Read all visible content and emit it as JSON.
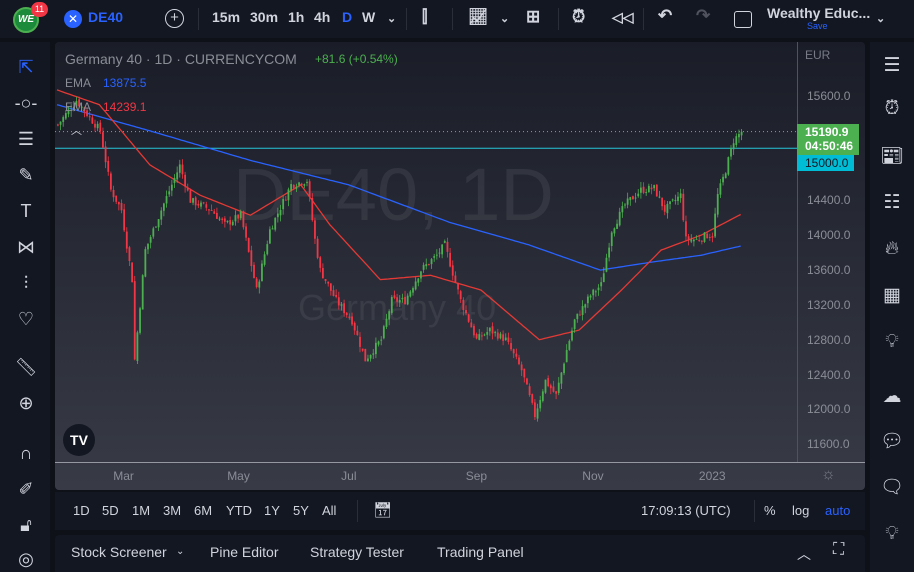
{
  "topbar": {
    "notif_count": "11",
    "symbol": "DE40",
    "intervals": [
      "15m",
      "30m",
      "1h",
      "4h",
      "D",
      "W"
    ],
    "active_interval": "D",
    "layout_name": "Wealthy Educ...",
    "save_label": "Save"
  },
  "legend": {
    "title": "Germany 40 · 1D · CURRENCYCOM",
    "change": "+81.6 (+0.54%)",
    "ema1_label": "EMA",
    "ema1_value": "13875.5",
    "ema2_label": "EMA",
    "ema2_value": "14239.1"
  },
  "watermark": {
    "main": "DE40, 1D",
    "sub": "Germany 40"
  },
  "price_axis": {
    "currency": "EUR",
    "last_price": "15190.9",
    "countdown": "04:50:46",
    "line_price": "15000.0"
  },
  "bottom": {
    "ranges": [
      "1D",
      "5D",
      "1M",
      "3M",
      "6M",
      "YTD",
      "1Y",
      "5Y",
      "All"
    ],
    "time": "17:09:13 (UTC)",
    "pct": "%",
    "log": "log",
    "auto": "auto"
  },
  "panel": {
    "tabs": [
      "Stock Screener",
      "Pine Editor",
      "Strategy Tester",
      "Trading Panel"
    ]
  },
  "colors": {
    "up": "#4caf50",
    "down": "#f23645",
    "ema_blue": "#2962ff",
    "ema_red": "#e53935",
    "hline": "#26c6da",
    "accent": "#2962ff"
  },
  "chart_data": {
    "type": "candlestick",
    "title": "Germany 40 · 1D · CURRENCYCOM",
    "ylim": [
      11400,
      15900
    ],
    "yticks": [
      15600,
      15200,
      14800,
      14400,
      14000,
      13600,
      13200,
      12800,
      12400,
      12000,
      11600
    ],
    "ytick_labels": [
      "15600.0",
      "14400.0",
      "14000.0",
      "13600.0",
      "13200.0",
      "12800.0",
      "12400.0",
      "12000.0",
      "11600.0"
    ],
    "xticks": [
      {
        "bar": 25,
        "label": "Mar"
      },
      {
        "bar": 68,
        "label": "May"
      },
      {
        "bar": 111,
        "label": "Jul"
      },
      {
        "bar": 158,
        "label": "Sep"
      },
      {
        "bar": 202,
        "label": "Nov"
      },
      {
        "bar": 246,
        "label": "2023"
      }
    ],
    "bars": 258,
    "close_path": [
      [
        0,
        15270
      ],
      [
        7,
        15550
      ],
      [
        16,
        15200
      ],
      [
        20,
        14520
      ],
      [
        24,
        14290
      ],
      [
        28,
        13490
      ],
      [
        29,
        12570
      ],
      [
        33,
        13830
      ],
      [
        39,
        14290
      ],
      [
        46,
        14800
      ],
      [
        50,
        14400
      ],
      [
        58,
        14290
      ],
      [
        63,
        14120
      ],
      [
        69,
        14230
      ],
      [
        75,
        13370
      ],
      [
        80,
        14060
      ],
      [
        88,
        14580
      ],
      [
        94,
        14630
      ],
      [
        97,
        13950
      ],
      [
        99,
        13600
      ],
      [
        105,
        13250
      ],
      [
        111,
        13020
      ],
      [
        116,
        12570
      ],
      [
        122,
        12800
      ],
      [
        126,
        13250
      ],
      [
        131,
        13250
      ],
      [
        137,
        13600
      ],
      [
        143,
        13770
      ],
      [
        146,
        13890
      ],
      [
        152,
        13250
      ],
      [
        158,
        12800
      ],
      [
        163,
        12910
      ],
      [
        169,
        12800
      ],
      [
        175,
        12450
      ],
      [
        180,
        11930
      ],
      [
        184,
        12330
      ],
      [
        188,
        12160
      ],
      [
        192,
        12680
      ],
      [
        195,
        13020
      ],
      [
        201,
        13310
      ],
      [
        205,
        13430
      ],
      [
        209,
        14060
      ],
      [
        214,
        14350
      ],
      [
        220,
        14520
      ],
      [
        225,
        14540
      ],
      [
        229,
        14290
      ],
      [
        235,
        14460
      ],
      [
        237,
        13950
      ],
      [
        241,
        13950
      ],
      [
        245,
        14000
      ],
      [
        247,
        14000
      ],
      [
        249,
        14460
      ],
      [
        252,
        14750
      ],
      [
        255,
        15090
      ],
      [
        258,
        15190
      ]
    ],
    "ema_blue": [
      [
        0,
        15500
      ],
      [
        35,
        15200
      ],
      [
        73,
        14860
      ],
      [
        110,
        14580
      ],
      [
        148,
        14150
      ],
      [
        178,
        13890
      ],
      [
        205,
        13600
      ],
      [
        224,
        13690
      ],
      [
        243,
        13770
      ],
      [
        258,
        13876
      ]
    ],
    "ema_red": [
      [
        0,
        15670
      ],
      [
        16,
        15500
      ],
      [
        35,
        14810
      ],
      [
        54,
        14460
      ],
      [
        73,
        14230
      ],
      [
        92,
        14580
      ],
      [
        103,
        14120
      ],
      [
        122,
        13490
      ],
      [
        141,
        13540
      ],
      [
        160,
        13370
      ],
      [
        182,
        12800
      ],
      [
        197,
        12910
      ],
      [
        213,
        13370
      ],
      [
        228,
        13830
      ],
      [
        243,
        14000
      ],
      [
        258,
        14239
      ]
    ],
    "hline": 15000,
    "last": 15190.9
  }
}
